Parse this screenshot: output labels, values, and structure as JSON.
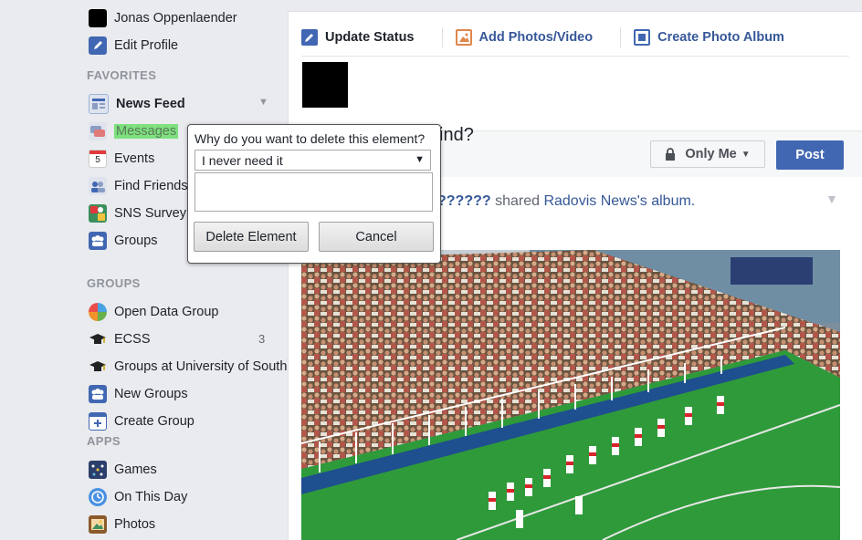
{
  "sidebar": {
    "profile_name": "Jonas Oppenlaender",
    "edit_profile": "Edit Profile",
    "favorites_header": "FAVORITES",
    "favorites": [
      {
        "label": "News Feed",
        "icon": "news-feed-icon",
        "bold": true
      },
      {
        "label": "Messages",
        "icon": "messages-icon",
        "highlight": "#7ee07e"
      },
      {
        "label": "Events",
        "icon": "calendar-icon",
        "icon_text": "5"
      },
      {
        "label": "Find Friends",
        "icon": "find-friends-icon"
      },
      {
        "label": "SNS Survey",
        "icon": "survey-icon"
      },
      {
        "label": "Groups",
        "icon": "groups-icon"
      }
    ],
    "groups_header": "GROUPS",
    "groups": [
      {
        "label": "Open Data Group",
        "icon": "globe-icon"
      },
      {
        "label": "ECSS",
        "icon": "graduation-cap-icon",
        "count": "3"
      },
      {
        "label": "Groups at University of Southampton",
        "icon": "graduation-cap-icon"
      },
      {
        "label": "New Groups",
        "icon": "groups-icon"
      },
      {
        "label": "Create Group",
        "icon": "create-group-icon"
      }
    ],
    "apps_header": "APPS",
    "apps": [
      {
        "label": "Games",
        "icon": "games-icon"
      },
      {
        "label": "On This Day",
        "icon": "on-this-day-icon"
      },
      {
        "label": "Photos",
        "icon": "photos-icon"
      }
    ]
  },
  "composer": {
    "tabs": [
      {
        "label": "Update Status",
        "icon": "pencil-icon",
        "active": true
      },
      {
        "label": "Add Photos/Video",
        "icon": "photo-icon"
      },
      {
        "label": "Create Photo Album",
        "icon": "album-icon"
      }
    ],
    "prompt_fragment": "ind?",
    "privacy_label": "Only Me",
    "post_label": "Post"
  },
  "story": {
    "author": "??????",
    "action": " shared ",
    "page": "Radovis News",
    "suffix": "'s album."
  },
  "popup": {
    "question": "Why do you want to delete this element?",
    "selected_reason": "I never need it",
    "textarea_value": "",
    "delete_label": "Delete Element",
    "cancel_label": "Cancel"
  },
  "colors": {
    "brand_blue": "#4267b2",
    "link_blue": "#365899",
    "messages_highlight": "#7ee07e"
  }
}
